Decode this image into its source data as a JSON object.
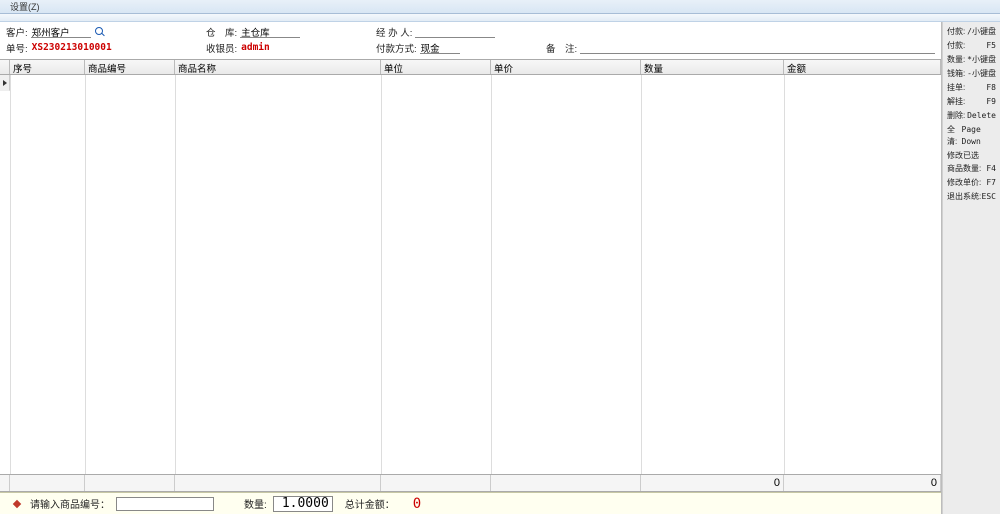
{
  "menu": {
    "settings": "设置(Z)"
  },
  "form": {
    "customer_label": "客户:",
    "customer": "郑州客户",
    "warehouse_label": "仓　库:",
    "warehouse": "主仓库",
    "handler_label": "经 办 人:",
    "handler": "",
    "order_label": "单号:",
    "order_no": "XS230213010001",
    "cashier_label": "收银员:",
    "cashier": "admin",
    "paytype_label": "付款方式:",
    "paytype": "现金",
    "remark_label": "备　注:",
    "remark": ""
  },
  "grid": {
    "headers": {
      "seq": "序号",
      "code": "商品编号",
      "name": "商品名称",
      "unit": "单位",
      "price": "单价",
      "qty": "数量",
      "amount": "金额"
    },
    "footer_qty": "0",
    "footer_amount": "0"
  },
  "bottom": {
    "prompt": "请输入商品编号：",
    "code_input": "",
    "qty_label": "数量:",
    "qty_value": "1.0000",
    "total_label": "总计金额：",
    "total_value": "0"
  },
  "shortcuts": {
    "pay": {
      "label": "付款:",
      "key": "/小键盘"
    },
    "pay2": {
      "label": "付款:",
      "key": "F5"
    },
    "qty": {
      "label": "数量:",
      "key": "*小键盘"
    },
    "cashbox": {
      "label": "钱箱:",
      "key": "-小键盘"
    },
    "hold": {
      "label": "挂单:",
      "key": "F8"
    },
    "unhold": {
      "label": "解挂:",
      "key": "F9"
    },
    "delete": {
      "label": "删除:",
      "key": "Delete"
    },
    "clear": {
      "label": "全清:",
      "key": "Page Down"
    },
    "group": "修改已选",
    "mod_qty": {
      "label": "商品数量:",
      "key": "F4"
    },
    "mod_price": {
      "label": "修改单价:",
      "key": "F7"
    },
    "exit": {
      "label": "退出系统:",
      "key": "ESC"
    }
  }
}
